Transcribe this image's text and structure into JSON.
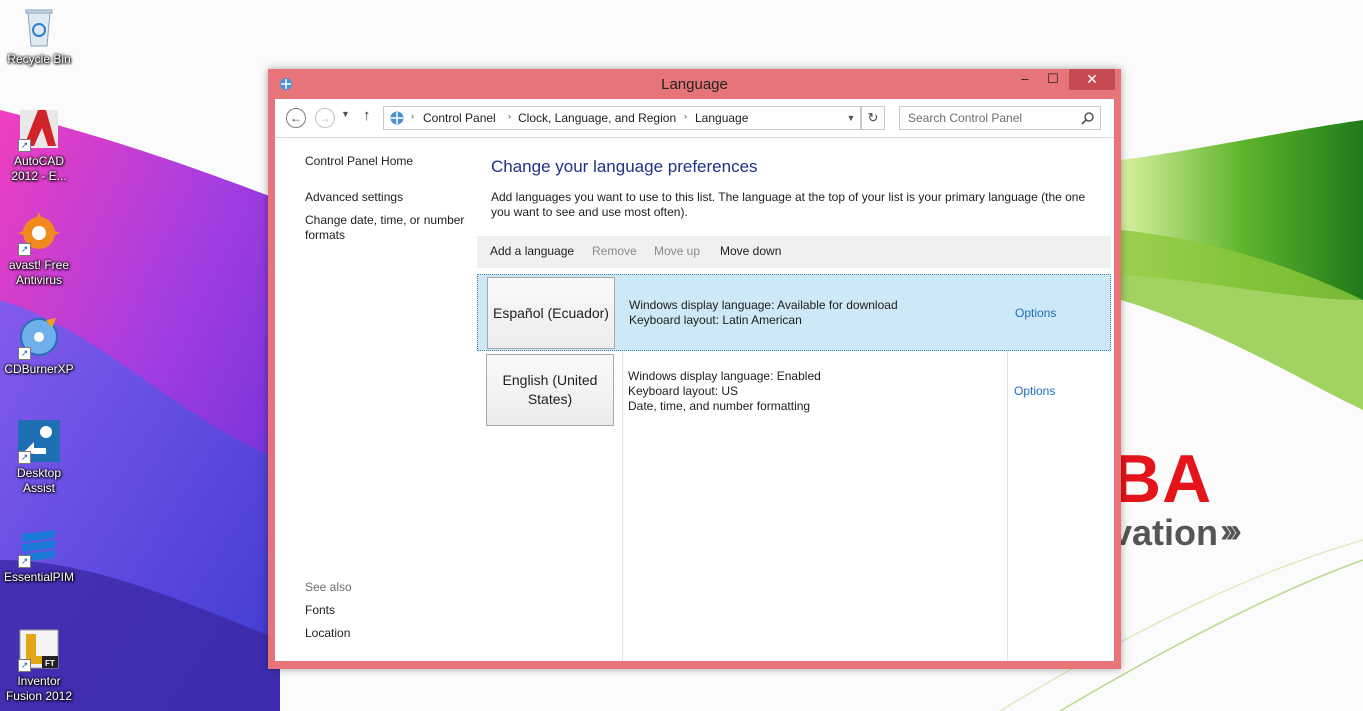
{
  "desktop": {
    "brand_name": "BA",
    "brand_tagline": "vation",
    "brand_chevrons": "›››",
    "icons": [
      {
        "name": "recycle-bin",
        "label": "Recycle Bin"
      },
      {
        "name": "autocad",
        "label": "AutoCAD 2012 - E..."
      },
      {
        "name": "avast",
        "label": "avast! Free Antivirus"
      },
      {
        "name": "cdburnerxp",
        "label": "CDBurnerXP"
      },
      {
        "name": "desktop-assist",
        "label": "Desktop Assist"
      },
      {
        "name": "essentialpim",
        "label": "EssentialPIM"
      },
      {
        "name": "inventor-fusion",
        "label": "Inventor Fusion 2012"
      }
    ]
  },
  "window": {
    "title": "Language",
    "caption_min": "–",
    "caption_max": "☐",
    "caption_close": "✕",
    "accent_color": "#e67478"
  },
  "navbar": {
    "back": "←",
    "forward": "→",
    "history": "▼",
    "up": "↑",
    "breadcrumbs": [
      "Control Panel",
      "Clock, Language, and Region",
      "Language"
    ],
    "separator": "›",
    "dropdown": "▼",
    "refresh": "↻",
    "search_placeholder": "Search Control Panel"
  },
  "left_pane": {
    "home": "Control Panel Home",
    "links": [
      "Advanced settings",
      "Change date, time, or number formats"
    ],
    "see_also_title": "See also",
    "see_also": [
      "Fonts",
      "Location"
    ]
  },
  "main": {
    "title": "Change your language preferences",
    "description": "Add languages you want to use to this list. The language at the top of your list is your primary language (the one you want to see and use most often).",
    "toolbar": {
      "add": "Add a language",
      "remove": "Remove",
      "move_up": "Move up",
      "move_down": "Move down"
    },
    "languages": [
      {
        "name": "Español (Ecuador)",
        "details": [
          "Windows display language: Available for download",
          "Keyboard layout: Latin American"
        ],
        "options": "Options",
        "selected": true
      },
      {
        "name": "English (United States)",
        "details": [
          "Windows display language: Enabled",
          "Keyboard layout: US",
          "Date, time, and number formatting"
        ],
        "options": "Options",
        "selected": false
      }
    ]
  }
}
